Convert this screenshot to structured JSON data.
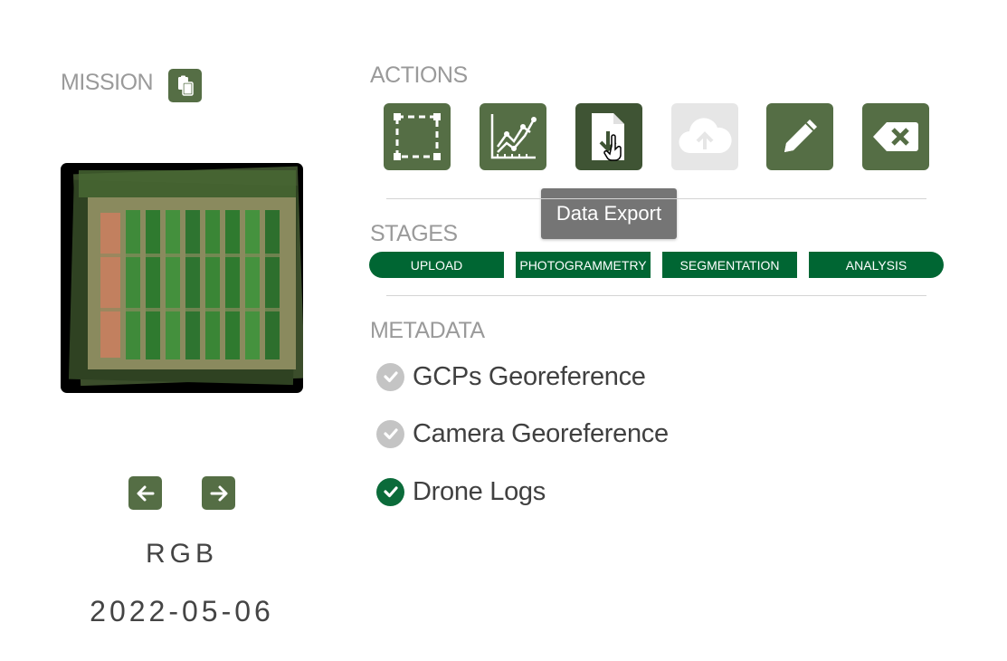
{
  "mission": {
    "title": "MISSION",
    "copy_icon": "clipboard-copy-icon",
    "layer_label": "RGB",
    "date": "2022-05-06",
    "prev_icon": "arrow-left-icon",
    "next_icon": "arrow-right-icon"
  },
  "actions": {
    "title": "ACTIONS",
    "buttons": [
      {
        "icon": "selection-frame-icon",
        "state": "enabled"
      },
      {
        "icon": "line-chart-icon",
        "state": "enabled"
      },
      {
        "icon": "file-download-icon",
        "state": "hovered"
      },
      {
        "icon": "cloud-upload-icon",
        "state": "disabled"
      },
      {
        "icon": "pencil-icon",
        "state": "enabled"
      },
      {
        "icon": "backspace-delete-icon",
        "state": "enabled"
      }
    ],
    "tooltip": "Data Export"
  },
  "stages": {
    "title": "STAGES",
    "items": [
      "UPLOAD",
      "PHOTOGRAMMETRY",
      "SEGMENTATION",
      "ANALYSIS"
    ]
  },
  "metadata": {
    "title": "METADATA",
    "items": [
      {
        "label": "GCPs Georeference",
        "status": "pending"
      },
      {
        "label": "Camera Georeference",
        "status": "pending"
      },
      {
        "label": "Drone Logs",
        "status": "complete"
      }
    ]
  },
  "colors": {
    "button_green": "#556e45",
    "stage_green": "#006633",
    "check_complete": "#0b6b3a",
    "check_pending": "#c4c4c4",
    "disabled_button": "#e6e6e6",
    "tooltip_bg": "#757575"
  }
}
